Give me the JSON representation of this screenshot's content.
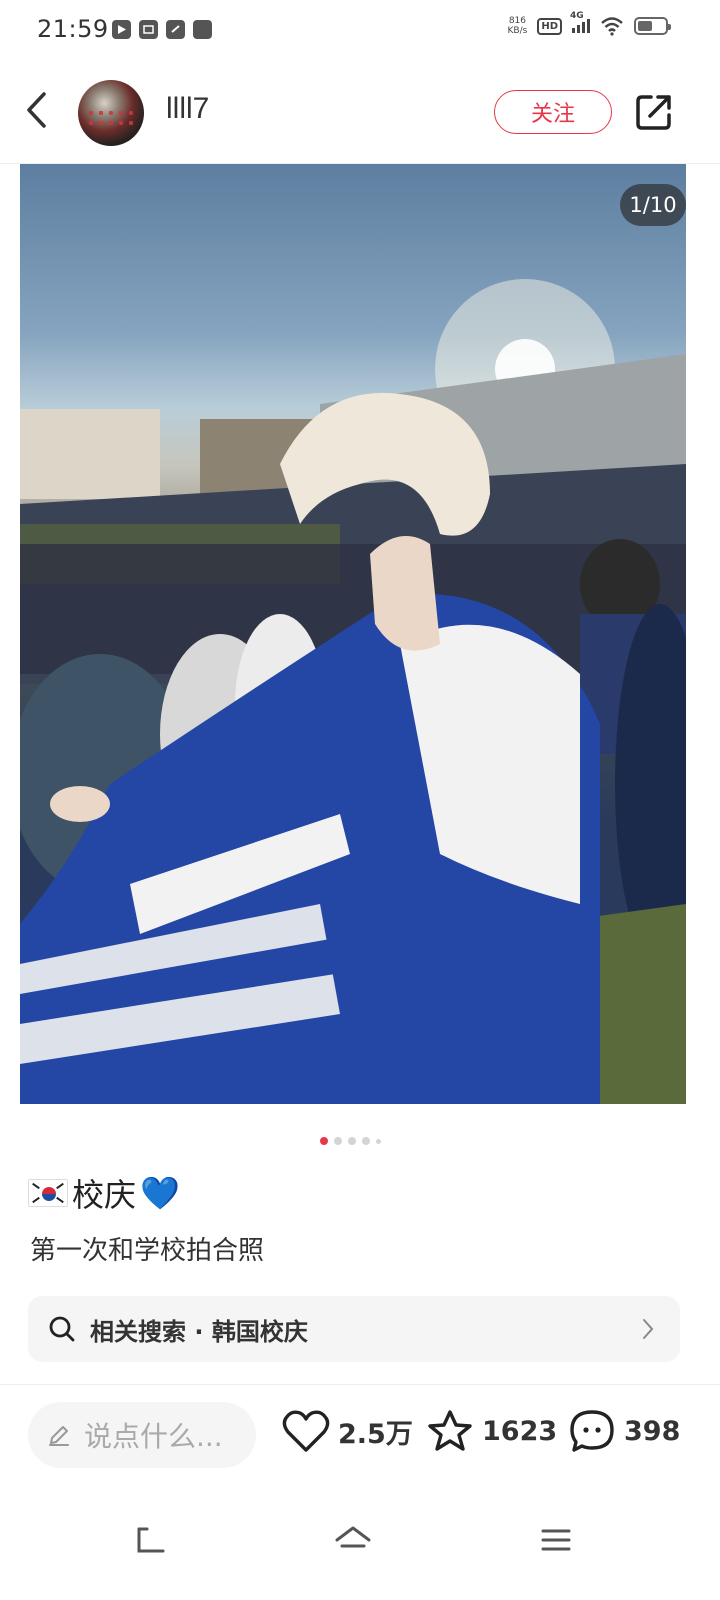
{
  "status_bar": {
    "time": "21:59",
    "net_speed_value": "816",
    "net_speed_unit": "KB/s",
    "hd_label": "HD",
    "network_type": "4G",
    "battery_level": 0.55
  },
  "header": {
    "username": "llll7",
    "follow_label": "关注"
  },
  "photo": {
    "counter": "1/10",
    "current_index": 1,
    "total": 10
  },
  "post": {
    "title_text": "校庆",
    "title_emoji_suffix": "💙",
    "body": "第一次和学校拍合照"
  },
  "related_search": {
    "label": "相关搜索 · 韩国校庆"
  },
  "bottom_bar": {
    "comment_placeholder": "说点什么...",
    "likes": "2.5万",
    "stars": "1623",
    "comments": "398"
  },
  "colors": {
    "accent": "#e8374a",
    "text": "#222222",
    "muted": "#aaaaaa"
  }
}
